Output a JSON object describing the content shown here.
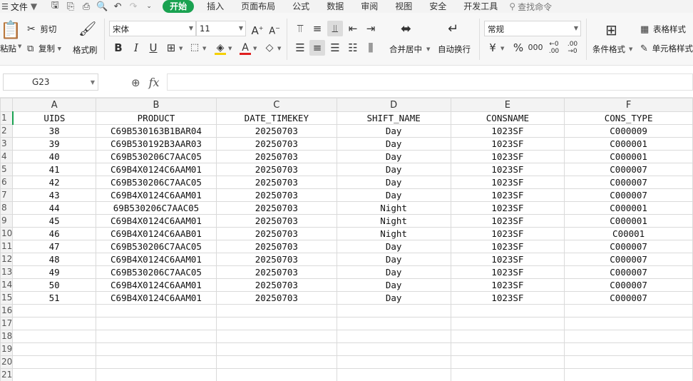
{
  "menu": {
    "file_label": "文件",
    "tabs": [
      {
        "label": "开始",
        "active": true
      },
      {
        "label": "插入"
      },
      {
        "label": "页面布局"
      },
      {
        "label": "公式"
      },
      {
        "label": "数据"
      },
      {
        "label": "审阅"
      },
      {
        "label": "视图"
      },
      {
        "label": "安全"
      },
      {
        "label": "开发工具"
      }
    ],
    "search_label": "查找命令"
  },
  "ribbon": {
    "paste_label": "粘贴",
    "cut_label": "剪切",
    "copy_label": "复制",
    "format_painter_label": "格式刷",
    "font_name": "宋体",
    "font_size": "11",
    "merge_label": "合并居中",
    "wrap_label": "自动换行",
    "number_format": "常规",
    "conditional_format_label": "条件格式",
    "table_style_label": "表格样式",
    "cell_style_label": "单元格样式",
    "accent_color": "#1aa251",
    "font_color": "#e02020",
    "fill_color": "#f5d000"
  },
  "formula_bar": {
    "cell_ref": "G23",
    "formula": ""
  },
  "sheet": {
    "column_letters": [
      "A",
      "B",
      "C",
      "D",
      "E",
      "F"
    ],
    "row_numbers": [
      "1",
      "2",
      "3",
      "4",
      "5",
      "6",
      "7",
      "8",
      "9",
      "10",
      "11",
      "12",
      "13",
      "14",
      "15",
      "16",
      "17",
      "18",
      "19",
      "20",
      "21"
    ],
    "headers": [
      "UIDS",
      "PRODUCT",
      "DATE_TIMEKEY",
      "SHIFT_NAME",
      "CONSNAME",
      "CONS_TYPE"
    ],
    "rows": [
      [
        "38",
        "C69B530163B1BAR04",
        "20250703",
        "Day",
        "1023SF",
        "C000009"
      ],
      [
        "39",
        "C69B530192B3AAR03",
        "20250703",
        "Day",
        "1023SF",
        "C000001"
      ],
      [
        "40",
        "C69B530206C7AAC05",
        "20250703",
        "Day",
        "1023SF",
        "C000001"
      ],
      [
        "41",
        "C69B4X0124C6AAM01",
        "20250703",
        "Day",
        "1023SF",
        "C000007"
      ],
      [
        "42",
        "C69B530206C7AAC05",
        "20250703",
        "Day",
        "1023SF",
        "C000007"
      ],
      [
        "43",
        "C69B4X0124C6AAM01",
        "20250703",
        "Day",
        "1023SF",
        "C000007"
      ],
      [
        "44",
        "69B530206C7AAC05",
        "20250703",
        "Night",
        "1023SF",
        "C000001"
      ],
      [
        "45",
        "C69B4X0124C6AAM01",
        "20250703",
        "Night",
        "1023SF",
        "C000001"
      ],
      [
        "46",
        "C69B4X0124C6AAB01",
        "20250703",
        "Night",
        "1023SF",
        "C00001"
      ],
      [
        "47",
        "C69B530206C7AAC05",
        "20250703",
        "Day",
        "1023SF",
        "C000007"
      ],
      [
        "48",
        "C69B4X0124C6AAM01",
        "20250703",
        "Day",
        "1023SF",
        "C000007"
      ],
      [
        "49",
        "C69B530206C7AAC05",
        "20250703",
        "Day",
        "1023SF",
        "C000007"
      ],
      [
        "50",
        "C69B4X0124C6AAM01",
        "20250703",
        "Day",
        "1023SF",
        "C000007"
      ],
      [
        "51",
        "C69B4X0124C6AAM01",
        "20250703",
        "Day",
        "1023SF",
        "C000007"
      ]
    ]
  }
}
